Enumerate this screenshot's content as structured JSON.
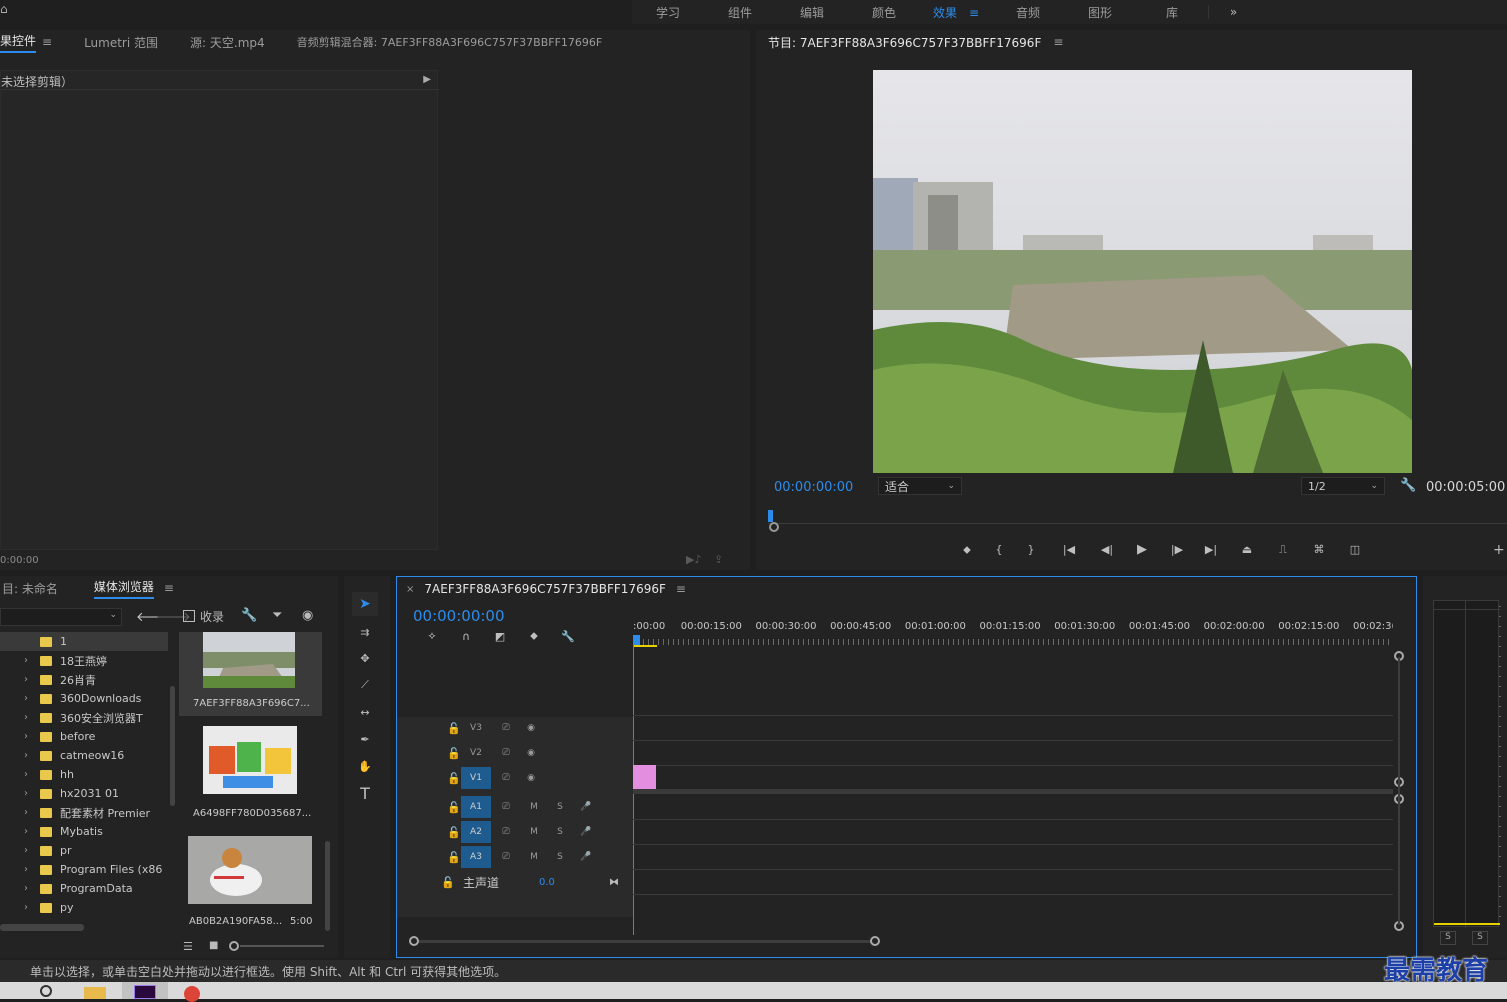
{
  "workspaces": [
    "学习",
    "组件",
    "编辑",
    "颜色",
    "效果",
    "音频",
    "图形",
    "库"
  ],
  "workspace_active": "效果",
  "workspace_more": "»",
  "source_panel": {
    "tabs": [
      "果控件",
      "Lumetri 范围",
      "源: 天空.mp4",
      "音频剪辑混合器: 7AEF3FF88A3F696C757F37BBFF17696F"
    ],
    "no_clip": "未选择剪辑）",
    "timecode": "0:00:00"
  },
  "program": {
    "title": "节目: 7AEF3FF88A3F696C757F37BBFF17696F",
    "timecode_in": "00:00:00:00",
    "fit": "适合",
    "resolution": "1/2",
    "timecode_out": "00:00:05:00"
  },
  "project": {
    "tabs": [
      "目: 未命名",
      "媒体浏览器"
    ],
    "collect_label": "收录",
    "folders": [
      "1",
      "18王燕婷",
      "26肖青",
      "360Downloads",
      "360安全浏览器T",
      "before",
      "catmeow16",
      "hh",
      "hx2031 01",
      "配套素材 Premier",
      "Mybatis",
      "pr",
      "Program Files (x86",
      "ProgramData",
      "py"
    ],
    "thumbs": [
      {
        "name": "7AEF3FF88A3F696C7...",
        "duration": ""
      },
      {
        "name": "A6498FF780D035687...",
        "duration": ""
      },
      {
        "name": "AB0B2A190FA58...",
        "duration": "5:00"
      }
    ]
  },
  "timeline": {
    "title": "7AEF3FF88A3F696C757F37BBFF17696F",
    "timecode": "00:00:00:00",
    "ruler": [
      ":00:00",
      "00:00:15:00",
      "00:00:30:00",
      "00:00:45:00",
      "00:01:00:00",
      "00:01:15:00",
      "00:01:30:00",
      "00:01:45:00",
      "00:02:00:00",
      "00:02:15:00",
      "00:02:3("
    ],
    "video_tracks": [
      "V3",
      "V2",
      "V1"
    ],
    "audio_tracks": [
      "A1",
      "A2",
      "A3"
    ],
    "mute": "M",
    "solo": "S",
    "master": "主声道",
    "master_value": "0.0"
  },
  "meter": {
    "s_left": "S",
    "s_right": "S"
  },
  "status_text": "单击以选择，或单击空白处并拖动以进行框选。使用 Shift、Alt 和 Ctrl 可获得其他选项。",
  "watermark": "最需教育",
  "colors": {
    "accent": "#2d8ceb",
    "clip": "#e48ee0",
    "folder": "#e8c94b"
  }
}
